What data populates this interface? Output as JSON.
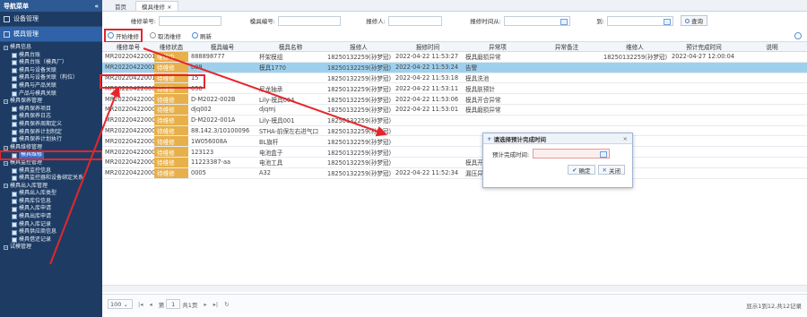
{
  "sidebar": {
    "title": "导航菜单",
    "collapse": "«",
    "groups": [
      "设备管理",
      "模具管理"
    ],
    "tree": [
      {
        "label": "模具信息",
        "lvl": 1
      },
      {
        "label": "模具台账",
        "lvl": 2
      },
      {
        "label": "模具台账（模具厂）",
        "lvl": 2
      },
      {
        "label": "模具与设备关联",
        "lvl": 2
      },
      {
        "label": "模具与设备关联（构位）",
        "lvl": 2
      },
      {
        "label": "模具与产品关联",
        "lvl": 2
      },
      {
        "label": "产品与模具关联",
        "lvl": 2
      },
      {
        "label": "模具保养管理",
        "lvl": 1
      },
      {
        "label": "模具保养项目",
        "lvl": 2
      },
      {
        "label": "模具保养日志",
        "lvl": 2
      },
      {
        "label": "模具保养周期定义",
        "lvl": 2
      },
      {
        "label": "模具保养计划制定",
        "lvl": 2
      },
      {
        "label": "模具保养计划执行",
        "lvl": 2
      },
      {
        "label": "模具维修管理",
        "lvl": 1
      },
      {
        "label": "模具维修",
        "lvl": 2,
        "sel": true
      },
      {
        "label": "模具监控管理",
        "lvl": 1
      },
      {
        "label": "模具监控信息",
        "lvl": 2
      },
      {
        "label": "模具监控器和设备绑定关系",
        "lvl": 2
      },
      {
        "label": "模具出入库管理",
        "lvl": 1
      },
      {
        "label": "模具出入库类型",
        "lvl": 2
      },
      {
        "label": "模具库位信息",
        "lvl": 2
      },
      {
        "label": "模具入库申请",
        "lvl": 2
      },
      {
        "label": "模具出库申请",
        "lvl": 2
      },
      {
        "label": "模具入库记录",
        "lvl": 2
      },
      {
        "label": "模具供应商信息",
        "lvl": 2
      },
      {
        "label": "模具借还记录",
        "lvl": 2
      },
      {
        "label": "试模管理",
        "lvl": 1
      }
    ]
  },
  "tabs": [
    {
      "label": "首页"
    },
    {
      "label": "模具维修 ×"
    }
  ],
  "search": {
    "repair_no": "维修单号:",
    "mold_no": "模具编号:",
    "reporter": "报修人:",
    "report_time": "报修时间从:",
    "to": "到:",
    "query": "查询"
  },
  "toolbar": {
    "start": "开始维修",
    "cancel": "取消维修",
    "refresh": "刷新"
  },
  "grid": {
    "headers": [
      "维修单号",
      "维修状态",
      "模具编号",
      "模具名称",
      "报修人",
      "报修时间",
      "异常项",
      "异常备注",
      "维修人",
      "预计完成时间",
      "说明"
    ],
    "rows": [
      [
        "MR202204220012",
        "维修中",
        "888898777",
        "杯架模组",
        "18250132259(孙梦冠)",
        "2022-04-22 11:53:27",
        "模具磨损异常",
        "",
        "18250132259(孙梦冠)",
        "2022-04-27 12:00:04",
        ""
      ],
      [
        "MR202204220011",
        "待维修",
        "b09",
        "模具1770",
        "18250132259(孙梦冠)",
        "2022-04-22 11:53:24",
        "告警",
        "",
        "",
        "",
        ""
      ],
      [
        "MR202204220010",
        "待维修",
        "15",
        "",
        "18250132259(孙梦冠)",
        "2022-04-22 11:53:18",
        "模具洗池",
        "",
        "",
        "",
        ""
      ],
      [
        "MR202204220009",
        "待维修",
        "056",
        "尼龙抽承",
        "18250132259(孙梦冠)",
        "2022-04-22 11:53:11",
        "模具肤预针",
        "",
        "",
        "",
        ""
      ],
      [
        "MR202204220008",
        "待维修",
        "D-M2022-002B",
        "Lily-模具004",
        "18250132259(孙梦冠)",
        "2022-04-22 11:53:06",
        "模具开合异常",
        "",
        "",
        "",
        ""
      ],
      [
        "MR202204220007",
        "待维修",
        "djq002",
        "djqmj",
        "18250132259(孙梦冠)",
        "2022-04-22 11:53:01",
        "模具磨损异常",
        "",
        "",
        "",
        ""
      ],
      [
        "MR202204220006",
        "待维修",
        "D-M2022-001A",
        "Lily-模具001",
        "18250132259(孙梦冠)",
        "",
        "",
        "",
        "",
        "",
        ""
      ],
      [
        "MR202204220005",
        "待维修",
        "88.142.3/10100096",
        "STHA-前保左右进气口",
        "18250132259(孙梦冠)",
        "",
        "",
        "",
        "",
        "",
        ""
      ],
      [
        "MR202204220004",
        "待维修",
        "1W056008A",
        "BL旗杆",
        "18250132259(孙梦冠)",
        "",
        "",
        "",
        "",
        "",
        ""
      ],
      [
        "MR202204220003",
        "待维修",
        "123123",
        "电池盒子",
        "18250132259(孙梦冠)",
        "",
        "",
        "",
        "",
        "",
        ""
      ],
      [
        "MR202204220002",
        "待维修",
        "11223387-aa",
        "电池工具",
        "18250132259(孙梦冠)",
        "",
        "模具开合异常",
        "",
        "",
        "",
        ""
      ],
      [
        "MR202204220001",
        "待维修",
        "0005",
        "A32",
        "18250132259(孙梦冠)",
        "2022-04-22 11:52:34",
        "漏压异常",
        "",
        "",
        "",
        ""
      ]
    ]
  },
  "pager": {
    "size": "100",
    "page_label": "第",
    "page": "1",
    "total_pages": "共1页",
    "info": "显示1到12,共12记录"
  },
  "dialog": {
    "title": "请选择预计完成时间",
    "close": "×",
    "field": "预计完成时间:",
    "ok": "确定",
    "cancel": "关闭"
  },
  "colors": {
    "sidebar": "#1e3c63",
    "selected_row": "#9ed0ee",
    "status": "#e8b04a",
    "highlight": "#e4262c"
  }
}
